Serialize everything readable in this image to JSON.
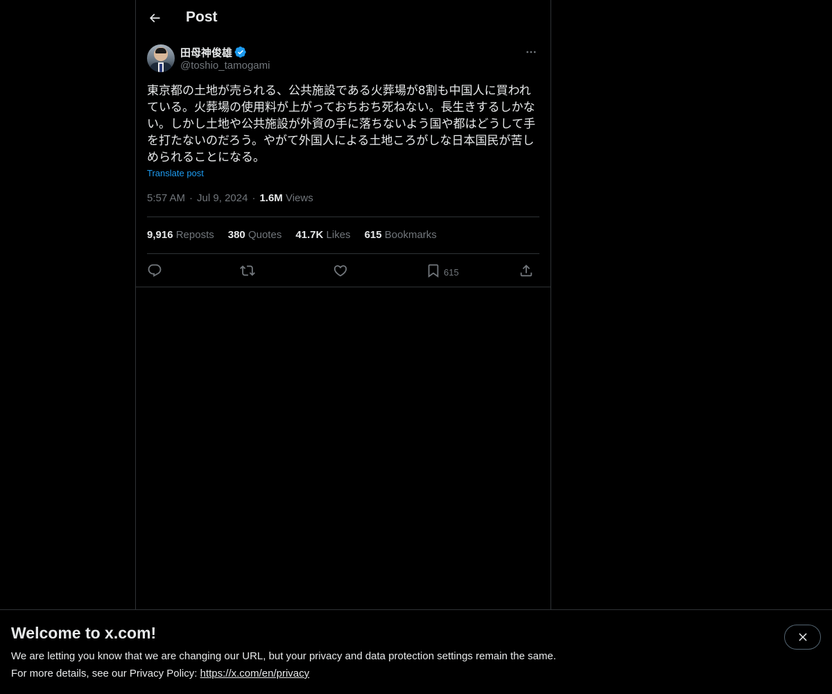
{
  "header": {
    "title": "Post",
    "back_icon": "arrow-left-icon"
  },
  "author": {
    "display_name": "田母神俊雄",
    "handle": "@toshio_tamogami",
    "verified": true,
    "verified_color": "#1d9bf0"
  },
  "tweet": {
    "text": "東京都の土地が売られる、公共施設である火葬場が8割も中国人に買われている。火葬場の使用料が上がっておちおち死ねない。長生きするしかない。しかし土地や公共施設が外資の手に落ちないよう国や都はどうして手を打たないのだろう。やがて外国人による土地ころがしな日本国民が苦しめられることになる。",
    "translate_label": "Translate post",
    "time": "5:57 AM",
    "date": "Jul 9, 2024",
    "views_count": "1.6M",
    "views_label": "Views",
    "separator": "·"
  },
  "stats": {
    "reposts_count": "9,916",
    "reposts_label": "Reposts",
    "quotes_count": "380",
    "quotes_label": "Quotes",
    "likes_count": "41.7K",
    "likes_label": "Likes",
    "bookmarks_count": "615",
    "bookmarks_label": "Bookmarks"
  },
  "actions": {
    "reply_icon": "reply-icon",
    "repost_icon": "repost-icon",
    "like_icon": "heart-icon",
    "bookmark_icon": "bookmark-icon",
    "bookmark_count": "615",
    "share_icon": "share-icon"
  },
  "banner": {
    "title": "Welcome to x.com!",
    "line1": "We are letting you know that we are changing our URL, but your privacy and data protection settings remain the same.",
    "line2_prefix": "For more details, see our Privacy Policy: ",
    "privacy_link": "https://x.com/en/privacy",
    "close_icon": "close-icon"
  },
  "colors": {
    "background": "#000000",
    "text_primary": "#e7e9ea",
    "text_secondary": "#71767b",
    "accent": "#1d9bf0",
    "border": "#2f3336"
  }
}
